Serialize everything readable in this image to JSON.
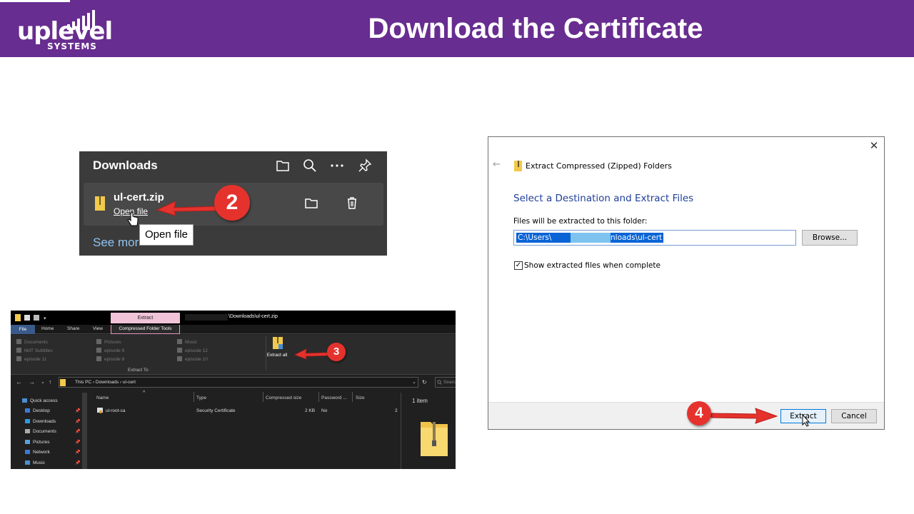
{
  "header": {
    "logo_main": "uplevel",
    "logo_sub": "SYSTEMS",
    "title": "Download the Certificate",
    "bg_color": "#682d90"
  },
  "downloads_panel": {
    "title": "Downloads",
    "icons": [
      "folder-icon",
      "search-icon",
      "more-icon",
      "pin-icon"
    ],
    "file_name": "ul-cert.zip",
    "open_link": "Open file",
    "tooltip": "Open file",
    "see_more": "See mor",
    "step_badge": "2"
  },
  "explorer": {
    "extract_tab": "Extract",
    "window_path": "\\Downloads\\ul-cert.zip",
    "tabs": [
      "File",
      "Home",
      "Share",
      "View",
      "Compressed Folder Tools"
    ],
    "ribbon_items": [
      "Documents",
      "MdT Subtitles",
      "episode 11",
      "Pictures",
      "episode 9",
      "episode 8",
      "Music",
      "episode 12",
      "episode 10"
    ],
    "extract_to_label": "Extract To",
    "extract_all_label": "Extract all",
    "step_badge": "3",
    "breadcrumb": [
      "This PC",
      "Downloads",
      "ul-cert"
    ],
    "search_placeholder": "Searc",
    "sidebar": [
      "Quick access",
      "Desktop",
      "Downloads",
      "Documents",
      "Pictures",
      "Network",
      "Music"
    ],
    "columns": [
      "Name",
      "Type",
      "Compressed size",
      "Password ...",
      "Size"
    ],
    "row": {
      "name": "ul-root-ca",
      "type": "Security Certificate",
      "compressed_size": "2 KB",
      "password": "No",
      "size": "2"
    },
    "item_count": "1 item"
  },
  "extract_dialog": {
    "window_title": "Extract Compressed (Zipped) Folders",
    "heading": "Select a Destination and Extract Files",
    "label": "Files will be extracted to this folder:",
    "path_start": "C:\\Users\\",
    "path_end": "\\Downloads\\ul-cert",
    "browse": "Browse...",
    "checkbox_label": "Show extracted files when complete",
    "checkbox_checked": true,
    "extract": "Extract",
    "cancel": "Cancel",
    "step_badge": "4"
  }
}
